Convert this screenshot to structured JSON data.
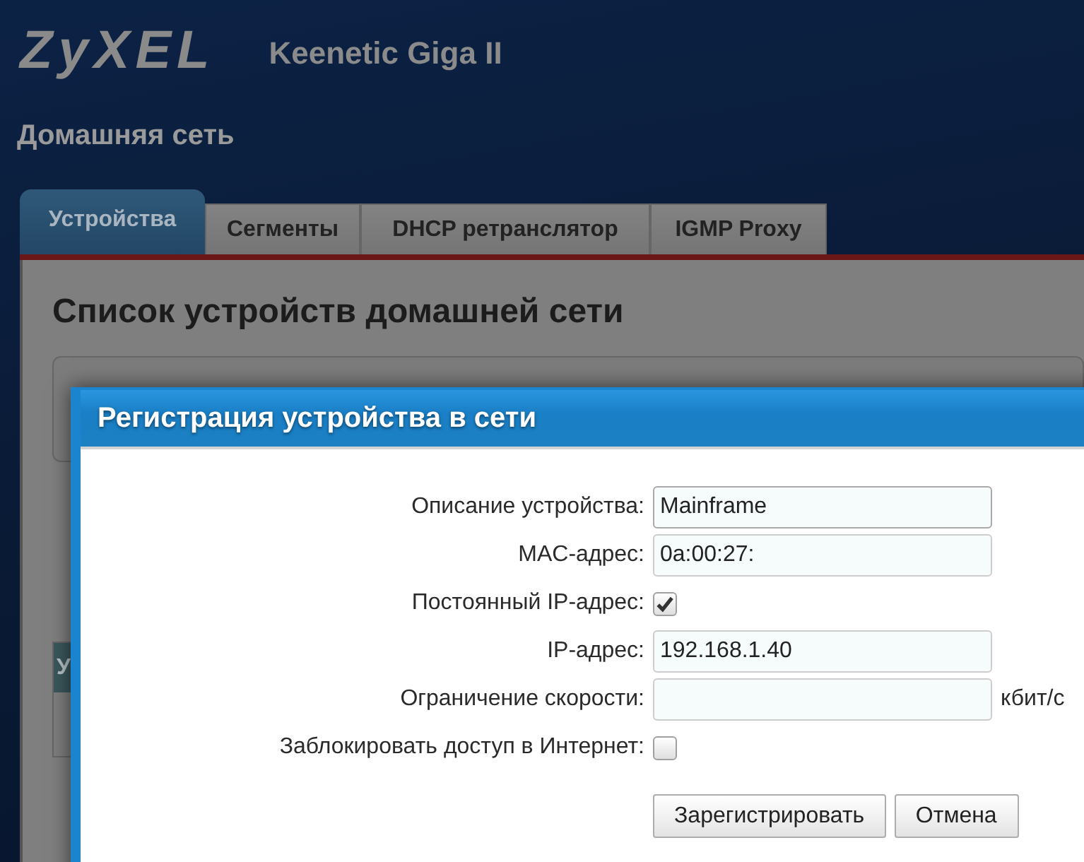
{
  "header": {
    "logo": "ZyXEL",
    "model": "Keenetic Giga II"
  },
  "page_title": "Домашняя сеть",
  "tabs": [
    {
      "label": "Устройства",
      "selected": true
    },
    {
      "label": "Сегменты",
      "selected": false
    },
    {
      "label": "DHCP ретранслятор",
      "selected": false
    },
    {
      "label": "IGMP Proxy",
      "selected": false
    }
  ],
  "section": {
    "title": "Список устройств домашней сети",
    "table": {
      "columns": [
        "У"
      ]
    }
  },
  "dialog": {
    "title": "Регистрация устройства в сети",
    "fields": [
      {
        "kind": "text",
        "label": "Описание устройства:",
        "value": "Mainframe"
      },
      {
        "kind": "text",
        "label": "MAC-адрес:",
        "value": "0a:00:27:"
      },
      {
        "kind": "checkbox",
        "label": "Постоянный IP-адрес:",
        "checked": true
      },
      {
        "kind": "text",
        "label": "IP-адрес:",
        "value": "192.168.1.40"
      },
      {
        "kind": "text",
        "label": "Ограничение скорости:",
        "unit": "кбит/с"
      },
      {
        "kind": "checkbox",
        "label": "Заблокировать доступ в Интернет:",
        "checked": false
      }
    ],
    "buttons": [
      "Зарегистрировать",
      "Отмена"
    ]
  }
}
